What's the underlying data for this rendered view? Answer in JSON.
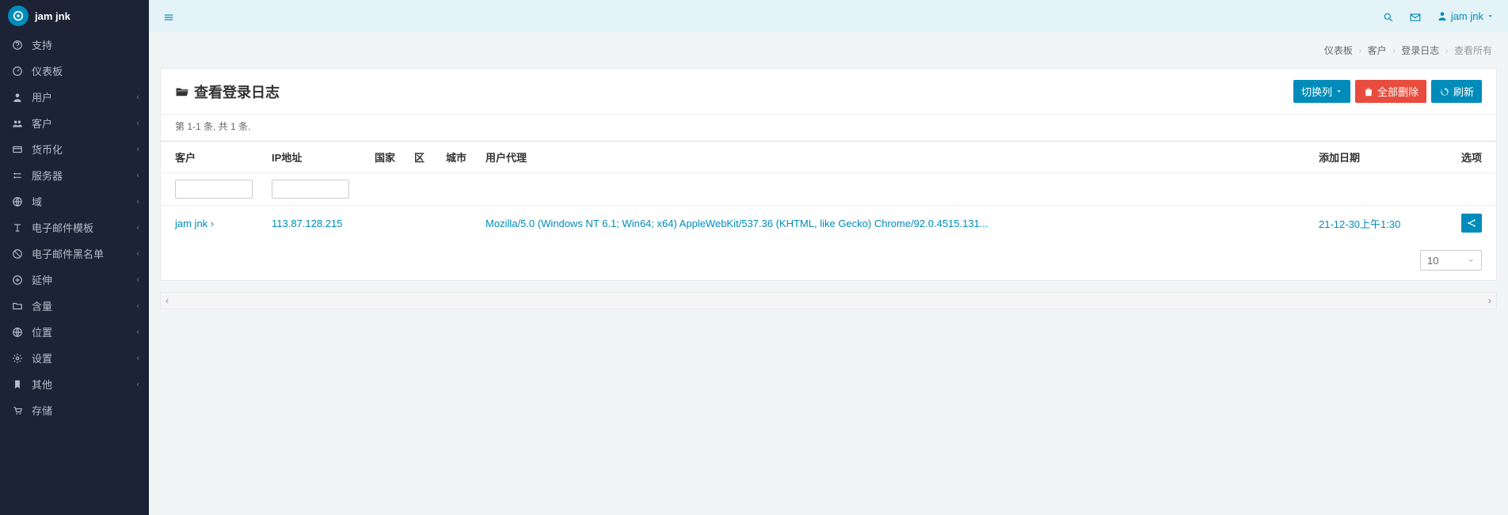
{
  "brand": {
    "name": "jam jnk"
  },
  "sidebar": {
    "items": [
      {
        "label": "支持",
        "icon": "question-circle-icon",
        "expandable": false
      },
      {
        "label": "仪表板",
        "icon": "dashboard-icon",
        "expandable": false
      },
      {
        "label": "用户",
        "icon": "user-icon",
        "expandable": true
      },
      {
        "label": "客户",
        "icon": "users-icon",
        "expandable": true
      },
      {
        "label": "货币化",
        "icon": "credit-card-icon",
        "expandable": true
      },
      {
        "label": "服务器",
        "icon": "server-icon",
        "expandable": true
      },
      {
        "label": "域",
        "icon": "globe-icon",
        "expandable": true
      },
      {
        "label": "电子邮件模板",
        "icon": "text-icon",
        "expandable": true
      },
      {
        "label": "电子邮件黑名单",
        "icon": "ban-icon",
        "expandable": true
      },
      {
        "label": "延伸",
        "icon": "plus-circle-icon",
        "expandable": true
      },
      {
        "label": "含量",
        "icon": "folder-icon",
        "expandable": true
      },
      {
        "label": "位置",
        "icon": "globe-icon",
        "expandable": true
      },
      {
        "label": "设置",
        "icon": "gear-icon",
        "expandable": true
      },
      {
        "label": "其他",
        "icon": "bookmark-icon",
        "expandable": true
      },
      {
        "label": "存储",
        "icon": "cart-icon",
        "expandable": false
      }
    ]
  },
  "topbar": {
    "user_label": "jam jnk"
  },
  "breadcrumb": {
    "dashboard": "仪表板",
    "customers": "客户",
    "login_log": "登录日志",
    "view_all": "查看所有"
  },
  "page": {
    "title": "查看登录日志",
    "toggle_cols": "切换列",
    "delete_all": "全部删除",
    "refresh": "刷新",
    "summary": "第 1-1 条, 共 1 条.",
    "page_size": "10"
  },
  "table": {
    "headers": {
      "customer": "客户",
      "ip": "IP地址",
      "country": "国家",
      "area": "区",
      "city": "城市",
      "ua": "用户代理",
      "date": "添加日期",
      "options": "选项"
    },
    "rows": [
      {
        "customer": "jam jnk",
        "ip": "113.87.128.215",
        "country": "",
        "area": "",
        "city": "",
        "ua": "Mozilla/5.0 (Windows NT 6.1; Win64; x64) AppleWebKit/537.36 (KHTML, like Gecko) Chrome/92.0.4515.131...",
        "date": "21-12-30上午1:30"
      }
    ]
  }
}
